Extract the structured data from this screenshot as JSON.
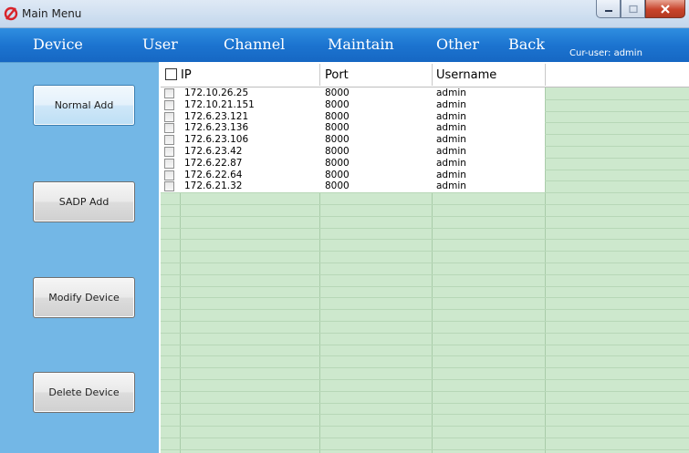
{
  "window": {
    "title": "Main Menu",
    "icon": "app-logo-icon"
  },
  "menu": {
    "items": [
      "Device",
      "User",
      "Channel",
      "Maintain",
      "Other",
      "Back"
    ],
    "cur_user": "Cur-user: admin"
  },
  "sidebar": {
    "buttons": [
      "Normal Add",
      "SADP Add",
      "Modify Device",
      "Delete Device"
    ]
  },
  "table": {
    "columns": [
      "IP",
      "Port",
      "Username"
    ],
    "rows": [
      [
        "172.10.26.25",
        "8000",
        "admin"
      ],
      [
        "172.10.21.151",
        "8000",
        "admin"
      ],
      [
        "172.6.23.121",
        "8000",
        "admin"
      ],
      [
        "172.6.23.136",
        "8000",
        "admin"
      ],
      [
        "172.6.23.106",
        "8000",
        "admin"
      ],
      [
        "172.6.23.42",
        "8000",
        "admin"
      ],
      [
        "172.6.22.87",
        "8000",
        "admin"
      ],
      [
        "172.6.22.64",
        "8000",
        "admin"
      ],
      [
        "172.6.21.32",
        "8000",
        "admin"
      ]
    ]
  },
  "colors": {
    "menubar": "#1c74d0",
    "sidebar": "#73b7e6",
    "grid_empty": "#cde8cd"
  }
}
